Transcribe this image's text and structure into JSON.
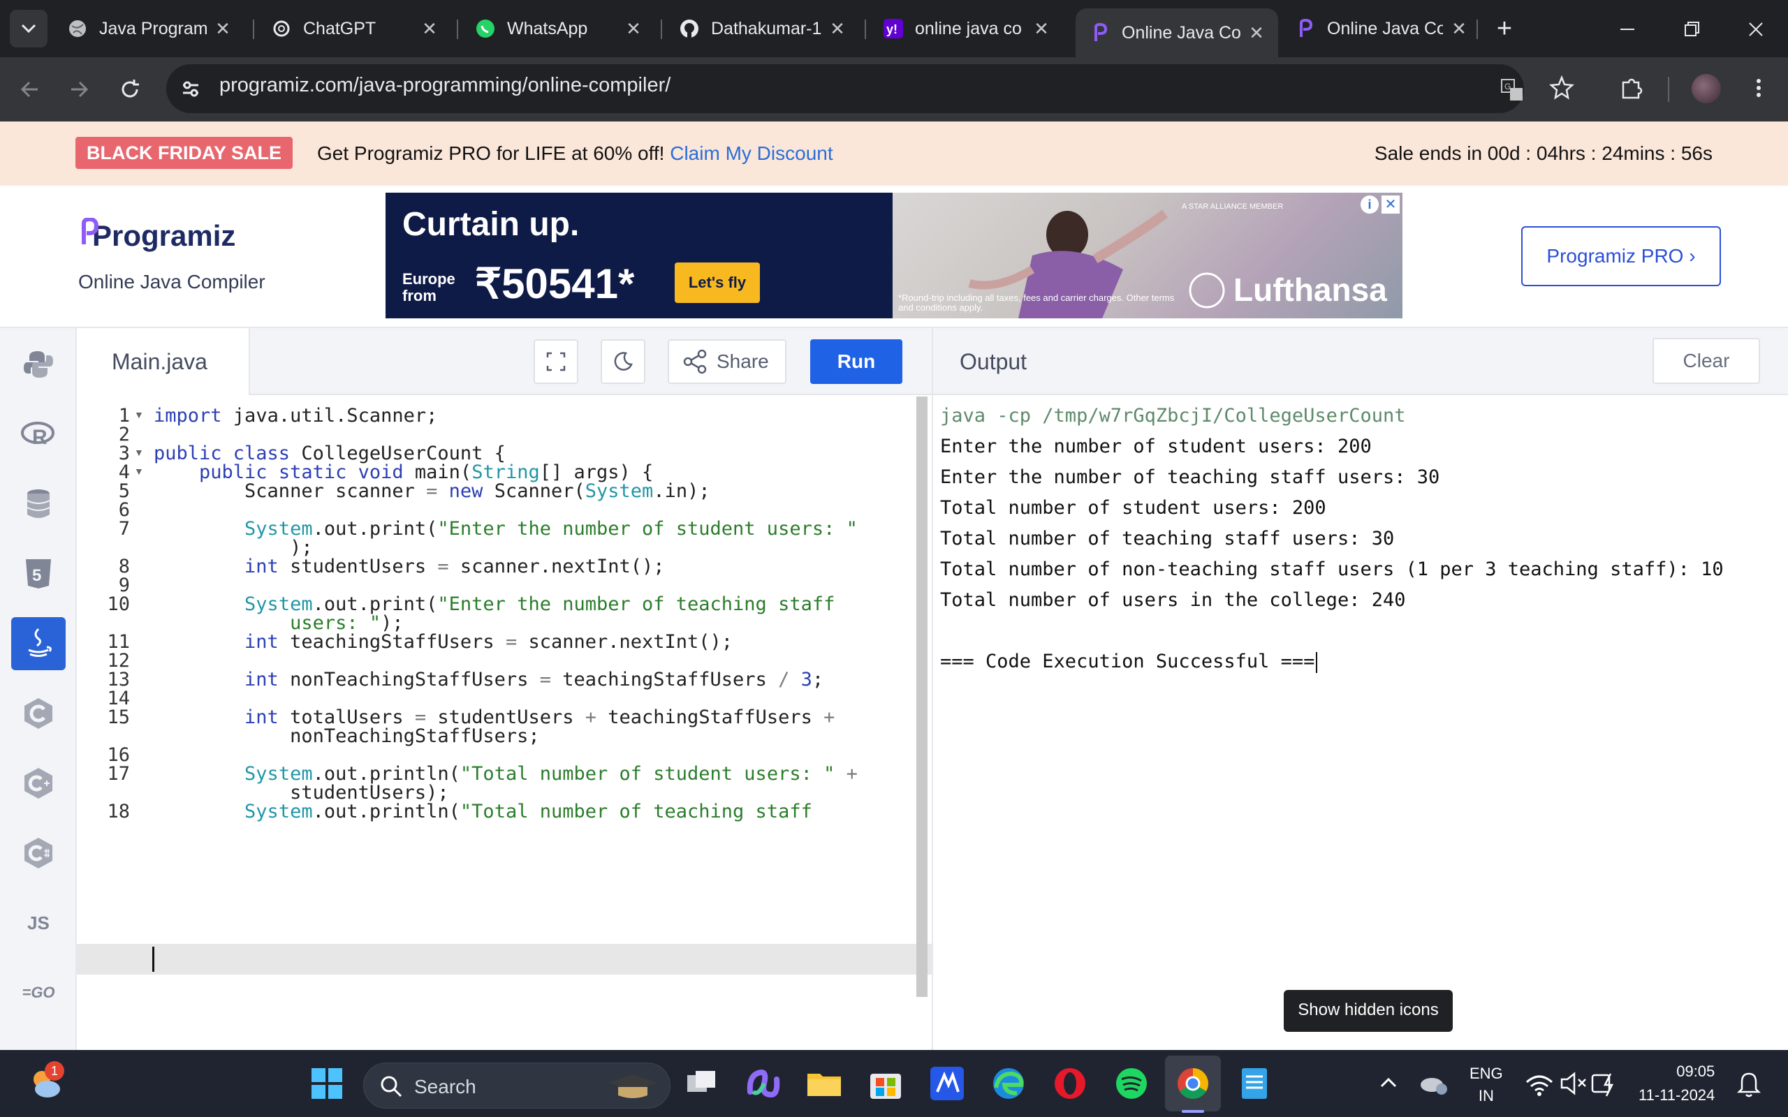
{
  "browser": {
    "tabs": [
      {
        "title": "Java Programm"
      },
      {
        "title": "ChatGPT"
      },
      {
        "title": "WhatsApp"
      },
      {
        "title": "Dathakumar-1"
      },
      {
        "title": "online java co"
      },
      {
        "title": "Online Java Co"
      },
      {
        "title": "Online Java Co"
      }
    ],
    "url": "programiz.com/java-programming/online-compiler/"
  },
  "banner": {
    "badge": "BLACK FRIDAY SALE",
    "text": "Get Programiz PRO for LIFE at 60% off!",
    "link": "Claim My Discount",
    "countdown": "Sale ends in 00d : 04hrs : 24mins : 56s"
  },
  "header": {
    "logo": "Programiz",
    "subtitle": "Online Java Compiler",
    "pro_button": "Programiz PRO ›"
  },
  "ad": {
    "headline": "Curtain up.",
    "region": "Europe from",
    "price": "₹50541*",
    "cta": "Let's fly",
    "brand": "Lufthansa",
    "alliance": "A STAR ALLIANCE MEMBER",
    "note": "*Round-trip including all taxes, fees and carrier charges. Other terms and conditions apply."
  },
  "sidebar": {
    "languages": [
      "Python",
      "R",
      "SQL",
      "HTML",
      "Java",
      "C",
      "C++",
      "C#",
      "JS",
      "GO"
    ]
  },
  "editor": {
    "file_name": "Main.java",
    "share_label": "Share",
    "run_label": "Run"
  },
  "output": {
    "title": "Output",
    "clear_label": "Clear",
    "lines": [
      "java -cp /tmp/w7rGqZbcjI/CollegeUserCount",
      "Enter the number of student users: 200",
      "Enter the number of teaching staff users: 30",
      "Total number of student users: 200",
      "Total number of teaching staff users: 30",
      "Total number of non-teaching staff users (1 per 3 teaching staff): 10",
      "Total number of users in the college: 240",
      "",
      "=== Code Execution Successful ==="
    ]
  },
  "tooltip": "Show hidden icons",
  "taskbar": {
    "search": "Search",
    "lang_top": "ENG",
    "lang_bottom": "IN",
    "time": "09:05",
    "date": "11-11-2024",
    "badge": "1"
  }
}
